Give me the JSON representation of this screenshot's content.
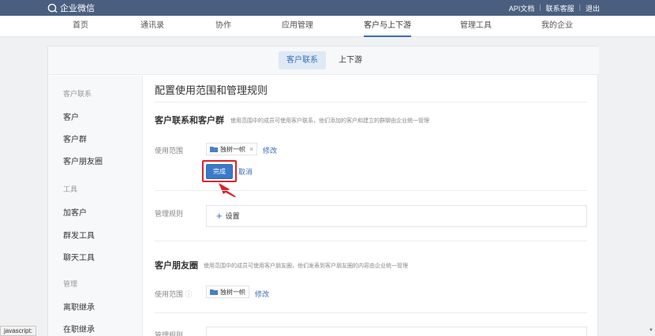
{
  "topbar": {
    "logo_text": "企业微信",
    "links": [
      "API文档",
      "联系客服",
      "退出"
    ]
  },
  "nav": {
    "items": [
      "首页",
      "通讯录",
      "协作",
      "应用管理",
      "客户与上下游",
      "管理工具",
      "我的企业"
    ],
    "active_index": 4
  },
  "subtabs": [
    "客户联系",
    "上下游"
  ],
  "sidebar": {
    "group1": "客户联系",
    "items1": [
      "客户",
      "客户群",
      "客户朋友圈"
    ],
    "group2": "工具",
    "items2": [
      "加客户",
      "群发工具",
      "聊天工具"
    ],
    "group3": "管理",
    "items3": [
      "离职继承",
      "在职继承"
    ]
  },
  "main": {
    "title": "配置使用范围和管理规则",
    "section1": {
      "title": "客户联系和客户群",
      "desc": "使用范围中的成员可使用客户联系，他们添加的客户和建立的群聊由企业统一管理",
      "scope_label": "使用范围",
      "tag": "独树一帜",
      "tag_close": "×",
      "edit_link": "修改",
      "done_button": "完成",
      "cancel_link": "取消",
      "rules_label": "管理规则",
      "rules_add": "设置"
    },
    "section2": {
      "title": "客户朋友圈",
      "desc": "使用范围中的成员可使用客户朋友圈，他们发表到客户朋友圈的内容由企业统一管理",
      "scope_label": "使用范围",
      "info_icon": "ⓘ",
      "tag": "独树一帜",
      "edit_link": "修改",
      "rules_label": "管理规则"
    }
  },
  "statusbar": {
    "text": "javascript:"
  },
  "colors": {
    "topbar": "#4a5f80",
    "accent": "#3b6fb6",
    "highlight": "#e0202a"
  }
}
